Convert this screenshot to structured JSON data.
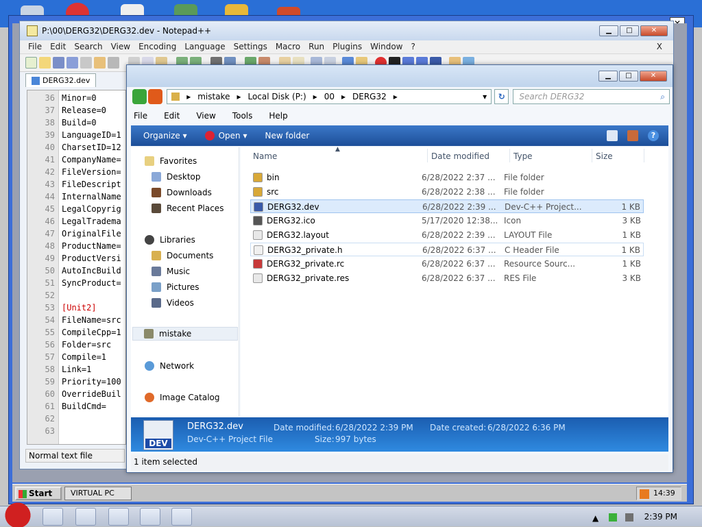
{
  "notepad": {
    "title": "P:\\00\\DERG32\\DERG32.dev - Notepad++",
    "menu": [
      "File",
      "Edit",
      "Search",
      "View",
      "Encoding",
      "Language",
      "Settings",
      "Macro",
      "Run",
      "Plugins",
      "Window",
      "?"
    ],
    "close_x": "X",
    "tab": "DERG32.dev",
    "lines": [
      {
        "n": "36",
        "t": "Minor=0"
      },
      {
        "n": "37",
        "t": "Release=0"
      },
      {
        "n": "38",
        "t": "Build=0"
      },
      {
        "n": "39",
        "t": "LanguageID=1"
      },
      {
        "n": "40",
        "t": "CharsetID=12"
      },
      {
        "n": "41",
        "t": "CompanyName="
      },
      {
        "n": "42",
        "t": "FileVersion="
      },
      {
        "n": "43",
        "t": "FileDescript"
      },
      {
        "n": "44",
        "t": "InternalName"
      },
      {
        "n": "45",
        "t": "LegalCopyrig"
      },
      {
        "n": "46",
        "t": "LegalTradema"
      },
      {
        "n": "47",
        "t": "OriginalFile"
      },
      {
        "n": "48",
        "t": "ProductName="
      },
      {
        "n": "49",
        "t": "ProductVersi"
      },
      {
        "n": "50",
        "t": "AutoIncBuild"
      },
      {
        "n": "51",
        "t": "SyncProduct="
      },
      {
        "n": "52",
        "t": ""
      },
      {
        "n": "53",
        "t": "[Unit2]"
      },
      {
        "n": "54",
        "t": "FileName=src"
      },
      {
        "n": "55",
        "t": "CompileCpp=1"
      },
      {
        "n": "56",
        "t": "Folder=src"
      },
      {
        "n": "57",
        "t": "Compile=1"
      },
      {
        "n": "58",
        "t": "Link=1"
      },
      {
        "n": "59",
        "t": "Priority=100"
      },
      {
        "n": "60",
        "t": "OverrideBuil"
      },
      {
        "n": "61",
        "t": "BuildCmd="
      },
      {
        "n": "62",
        "t": ""
      },
      {
        "n": "63",
        "t": ""
      }
    ],
    "status": "Normal text file"
  },
  "explorer": {
    "breadcrumb": [
      "mistake",
      "Local Disk (P:)",
      "00",
      "DERG32"
    ],
    "search_placeholder": "Search DERG32",
    "menu": [
      "File",
      "Edit",
      "View",
      "Tools",
      "Help"
    ],
    "cmd": {
      "organize": "Organize ▾",
      "open": "Open ▾",
      "new_folder": "New folder"
    },
    "nav": {
      "favorites": "Favorites",
      "desktop": "Desktop",
      "downloads": "Downloads",
      "recent": "Recent Places",
      "libraries": "Libraries",
      "documents": "Documents",
      "music": "Music",
      "pictures": "Pictures",
      "videos": "Videos",
      "mistake": "mistake",
      "network": "Network",
      "image_catalog": "Image Catalog"
    },
    "columns": {
      "name": "Name",
      "date": "Date modified",
      "type": "Type",
      "size": "Size"
    },
    "files": [
      {
        "name": "bin",
        "date": "6/28/2022 2:37 ...",
        "type": "File folder",
        "size": ""
      },
      {
        "name": "src",
        "date": "6/28/2022 2:38 ...",
        "type": "File folder",
        "size": ""
      },
      {
        "name": "DERG32.dev",
        "date": "6/28/2022 2:39 ...",
        "type": "Dev-C++ Project...",
        "size": "1 KB"
      },
      {
        "name": "DERG32.ico",
        "date": "5/17/2020 12:38...",
        "type": "Icon",
        "size": "3 KB"
      },
      {
        "name": "DERG32.layout",
        "date": "6/28/2022 2:39 ...",
        "type": "LAYOUT File",
        "size": "1 KB"
      },
      {
        "name": "DERG32_private.h",
        "date": "6/28/2022 6:37 ...",
        "type": "C Header File",
        "size": "1 KB"
      },
      {
        "name": "DERG32_private.rc",
        "date": "6/28/2022 6:37 ...",
        "type": "Resource Sourc...",
        "size": "1 KB"
      },
      {
        "name": "DERG32_private.res",
        "date": "6/28/2022 6:37 ...",
        "type": "RES File",
        "size": "3 KB"
      }
    ],
    "details": {
      "name": "DERG32.dev",
      "type": "Dev-C++ Project File",
      "modified_label": "Date modified:",
      "modified": "6/28/2022 2:39 PM",
      "created_label": "Date created:",
      "created": "6/28/2022 6:36 PM",
      "size_label": "Size:",
      "size": "997 bytes",
      "icon_text": "DEV"
    },
    "status": "1 item selected"
  },
  "vpc_taskbar": {
    "start": "Start",
    "item": "VIRTUAL PC",
    "time": "14:39"
  },
  "taskbar": {
    "time": "2:39 PM"
  },
  "colors": {
    "selection": "#dcebfc",
    "command_bar": "#1c4e98",
    "accent": "#2a67c0"
  }
}
